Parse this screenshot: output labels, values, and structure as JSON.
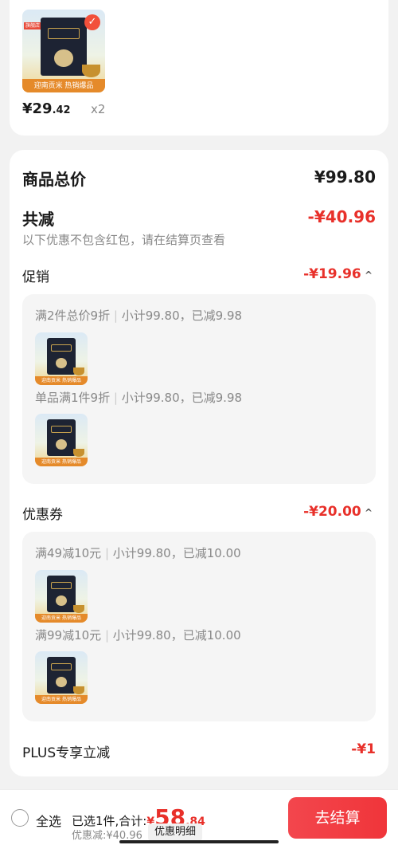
{
  "product": {
    "price_main": "¥29",
    "price_decimal": ".42",
    "quantity": "x2",
    "thumb_ribbon": "迎南贡米 热销爆品",
    "thumb_brand": "金素粮仓"
  },
  "summary": {
    "total_label": "商品总价",
    "total_value": "¥99.80",
    "discount_label": "共减",
    "discount_value": "-¥40.96",
    "discount_note": "以下优惠不包含红包，请在结算页查看"
  },
  "promo": {
    "label": "促销",
    "value": "-¥19.96",
    "items": [
      {
        "title": "满2件总价9折",
        "detail": "小计99.80，已减9.98"
      },
      {
        "title": "单品满1件9折",
        "detail": "小计99.80，已减9.98"
      }
    ]
  },
  "coupon": {
    "label": "优惠券",
    "value": "-¥20.00",
    "items": [
      {
        "title": "满49减10元",
        "detail": "小计99.80，已减10.00"
      },
      {
        "title": "满99减10元",
        "detail": "小计99.80，已减10.00"
      }
    ]
  },
  "plus": {
    "label": "PLUS专享立减",
    "value": "-¥1"
  },
  "footer": {
    "select_all": "全选",
    "selected_text": "已选1件,合计:",
    "total_currency": "¥",
    "total_int": "58",
    "total_dec": ".84",
    "discount_text": "优惠减:¥40.96",
    "detail_chip": "优惠明细",
    "checkout_button": "去结算"
  },
  "colors": {
    "accent": "#e8302a",
    "checkout": "#f0353a"
  },
  "icons": [
    "check-icon",
    "chevron-up-icon",
    "radio-icon"
  ]
}
